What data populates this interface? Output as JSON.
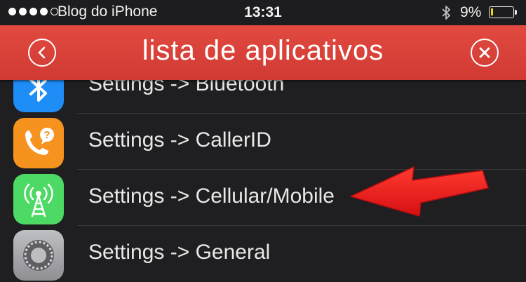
{
  "status_bar": {
    "carrier": "Blog do iPhone",
    "time": "13:31",
    "battery_percent": "9%",
    "battery_level": 0.09,
    "signal_bars": 4,
    "bluetooth_icon": "bluetooth-icon"
  },
  "navbar": {
    "title": "lista de aplicativos",
    "back_icon": "chevron-left-icon",
    "close_icon": "close-icon"
  },
  "rows": [
    {
      "label": "Settings -> Bluetooth",
      "icon": "bluetooth-icon",
      "icon_color": "#1e8df5"
    },
    {
      "label": "Settings -> CallerID",
      "icon": "phone-question-icon",
      "icon_color": "#f6921e"
    },
    {
      "label": "Settings -> Cellular/Mobile",
      "icon": "cellular-antenna-icon",
      "icon_color": "#4cd964"
    },
    {
      "label": "Settings -> General",
      "icon": "gear-icon",
      "icon_color": "#8e8e93"
    }
  ],
  "annotation": {
    "arrow_color": "#e8191c",
    "points_to": "Settings -> Cellular/Mobile"
  }
}
